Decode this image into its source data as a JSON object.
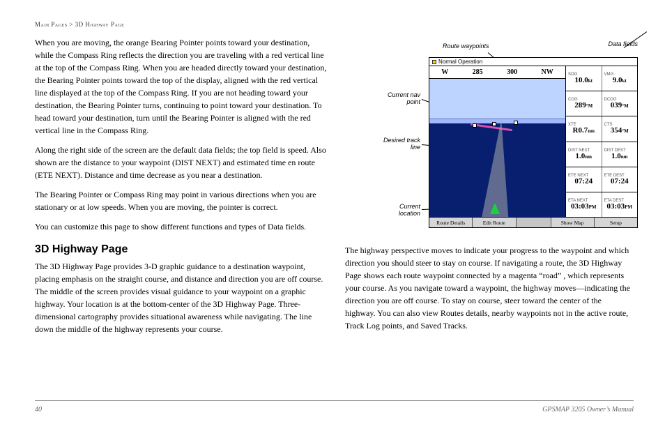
{
  "breadcrumb": {
    "root": "Main Pages",
    "sep": " > ",
    "leaf": "3D Highway Page"
  },
  "left": {
    "p1": "When you are moving, the orange Bearing Pointer points toward your destination, while the Compass Ring reflects the direction you are traveling with a red vertical line at the top of the Compass Ring. When you are headed directly toward your destination, the Bearing Pointer points toward the top of the display, aligned with the red vertical line displayed at the top of the Compass Ring. If you are not heading toward your destination, the Bearing Pointer turns, continuing to point toward your destination. To head toward your destination, turn until the Bearing Pointer is aligned with the red vertical line in the Compass Ring.",
    "p2": "Along the right side of the screen are the default data fields; the top field is speed. Also shown are the distance to your waypoint (DIST NEXT) and estimated time en route (ETE NEXT). Distance and time decrease as you near a destination.",
    "p3": "The Bearing Pointer or Compass Ring may point in various directions when you are stationary or at low speeds. When you are moving, the pointer is correct.",
    "p4": "You can customize this page to show different functions and types of Data fields.",
    "h2": "3D Highway Page",
    "p5": "The 3D Highway Page provides 3-D graphic guidance to a destination waypoint, placing emphasis on the straight course, and distance and direction you are off course. The middle of the screen provides visual guidance to your waypoint on a graphic highway. Your location is at the bottom-center of the 3D Highway Page. Three-dimensional cartography provides situational awareness while navigating. The line down the middle of the highway represents your course."
  },
  "right": {
    "p1": "The highway perspective moves to indicate your progress to the waypoint and which direction you should steer to stay on course. If navigating a route, the 3D Highway Page shows each route waypoint connected by a magenta “road” , which represents your course. As you navigate toward a waypoint, the highway moves—indicating the direction you are off course. To stay on course, steer toward the center of the highway. You can also view Routes details, nearby waypoints not in the active route, Track Log points, and Saved Tracks."
  },
  "callouts": {
    "route": "Route waypoints",
    "data": "Data fields",
    "navpt": "Current nav point",
    "track": "Desired track line",
    "loc": "Current location"
  },
  "device": {
    "title": "Normal Operation",
    "compass": {
      "w": "W",
      "t1": "285",
      "t2": "300",
      "nw": "NW"
    },
    "fields": [
      {
        "l1": "SOG",
        "v1": "10.0",
        "u1": "kt",
        "l2": "VMG",
        "v2": "9.0",
        "u2": "kt"
      },
      {
        "l1": "COG",
        "v1": "289",
        "u1": "°M",
        "l2": "DCOG",
        "v2": "039",
        "u2": "°M"
      },
      {
        "l1": "XTE",
        "v1": "R0.7",
        "u1": "nm",
        "l2": "CTS",
        "v2": "354",
        "u2": "°M"
      },
      {
        "l1": "DIST NEXT",
        "v1": "1.0",
        "u1": "nm",
        "l2": "DIST DEST",
        "v2": "1.0",
        "u2": "nm"
      },
      {
        "l1": "ETE NEXT",
        "v1": "07:24",
        "u1": "",
        "l2": "ETE DEST",
        "v2": "07:24",
        "u2": ""
      },
      {
        "l1": "ETA NEXT",
        "v1": "03:03",
        "u1": "PM",
        "l2": "ETA DEST",
        "v2": "03:03",
        "u2": "PM"
      }
    ],
    "softkeys": [
      "Route Details",
      "Edit Route",
      "",
      "Show Map",
      "Setup"
    ]
  },
  "footer": {
    "page": "40",
    "manual": "GPSMAP 3205 Owner’s Manual"
  },
  "chart_data": {
    "type": "table",
    "title": "3D Highway Page data fields",
    "series": [
      {
        "name": "SOG",
        "value": 10.0,
        "unit": "kt"
      },
      {
        "name": "VMG",
        "value": 9.0,
        "unit": "kt"
      },
      {
        "name": "COG",
        "value": 289,
        "unit": "°M"
      },
      {
        "name": "DCOG",
        "value": 39,
        "unit": "°M"
      },
      {
        "name": "XTE",
        "value": 0.7,
        "unit": "nm",
        "direction": "R"
      },
      {
        "name": "CTS",
        "value": 354,
        "unit": "°M"
      },
      {
        "name": "DIST NEXT",
        "value": 1.0,
        "unit": "nm"
      },
      {
        "name": "DIST DEST",
        "value": 1.0,
        "unit": "nm"
      },
      {
        "name": "ETE NEXT",
        "value": "07:24"
      },
      {
        "name": "ETE DEST",
        "value": "07:24"
      },
      {
        "name": "ETA NEXT",
        "value": "03:03 PM"
      },
      {
        "name": "ETA DEST",
        "value": "03:03 PM"
      }
    ],
    "compass_ticks": [
      "W",
      285,
      300,
      "NW"
    ]
  }
}
